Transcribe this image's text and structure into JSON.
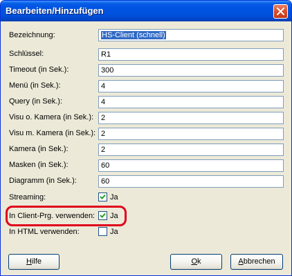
{
  "window": {
    "title": "Bearbeiten/Hinzufügen"
  },
  "icons": {
    "close": "close-icon",
    "check": "checkmark-icon"
  },
  "colors": {
    "titlebar": "#0054e3",
    "dialog_bg": "#ece9d8",
    "selection": "#316ac5",
    "highlight_frame": "#e0001a",
    "close_button": "#d9512f"
  },
  "fields": [
    {
      "label": "Bezeichnung:",
      "value": "HS-Client (schnell)",
      "selected": true
    },
    {
      "label": "Schlüssel:",
      "value": "R1"
    },
    {
      "label": "Timeout (in Sek.):",
      "value": "300"
    },
    {
      "label": "Menü (in Sek.):",
      "value": "4"
    },
    {
      "label": "Query (in Sek.):",
      "value": "4"
    },
    {
      "label": "Visu o. Kamera (in Sek.):",
      "value": "2"
    },
    {
      "label": "Visu m. Kamera (in Sek.):",
      "value": "2"
    },
    {
      "label": "Kamera (in Sek.):",
      "value": "2"
    },
    {
      "label": "Masken (in Sek.):",
      "value": "60"
    },
    {
      "label": "Diagramm (in Sek.):",
      "value": "60"
    }
  ],
  "checkboxes": [
    {
      "label": "Streaming:",
      "text": "Ja",
      "checked": true
    },
    {
      "label": "In Client-Prg. verwenden:",
      "text": "Ja",
      "checked": true
    },
    {
      "label": "In HTML verwenden:",
      "text": "Ja",
      "checked": false
    }
  ],
  "buttons": {
    "help": {
      "mnemonic": "H",
      "rest": "ilfe"
    },
    "ok": {
      "mnemonic": "O",
      "rest": "k"
    },
    "cancel": {
      "mnemonic": "A",
      "rest": "bbrechen"
    }
  }
}
